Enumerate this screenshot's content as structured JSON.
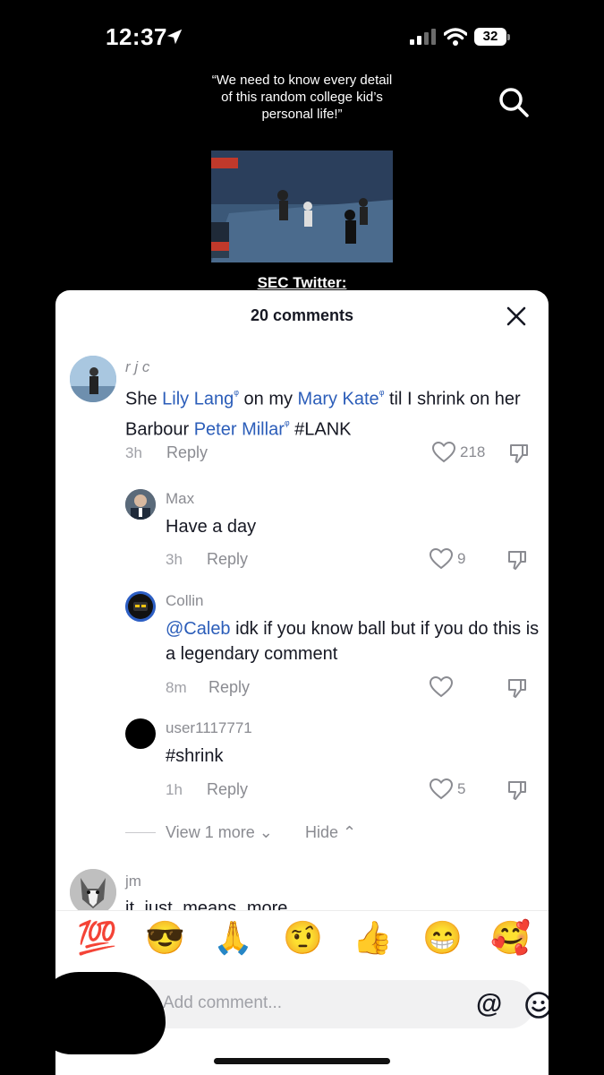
{
  "status_bar": {
    "time": "12:37",
    "battery": "32",
    "location_icon": "location-arrow-icon",
    "signal_icon": "cellular-signal-icon",
    "wifi_icon": "wifi-icon"
  },
  "video": {
    "caption_top": "“We need to know every detail of this random college kid’s personal life!”",
    "caption_bottom": "SEC Twitter:",
    "search_icon": "search-icon"
  },
  "sheet": {
    "header": "20 comments",
    "close_icon": "close-icon"
  },
  "comments": [
    {
      "user": "r j c",
      "text_parts": [
        "She ",
        "Lily Lang",
        " on my ",
        "Mary Kate",
        " til I shrink on her Barbour ",
        "Peter Millar",
        " #LANK"
      ],
      "time": "3h",
      "reply": "Reply",
      "likes": "218"
    },
    {
      "user": "Max",
      "text": "Have a day",
      "time": "3h",
      "reply": "Reply",
      "likes": "9"
    },
    {
      "user": "Collin",
      "mention": "@Caleb",
      "text": " idk if you know ball but if you do this is a legendary comment",
      "time": "8m",
      "reply": "Reply",
      "likes": ""
    },
    {
      "user": "user1117771",
      "text": "#shrink",
      "time": "1h",
      "reply": "Reply",
      "likes": "5"
    },
    {
      "user": "jm",
      "text": "it just means more"
    }
  ],
  "thread_controls": {
    "view_more": "View 1 more",
    "hide": "Hide"
  },
  "emoji_bar": [
    "💯",
    "😎",
    "🙏",
    "🤨",
    "👍",
    "😁",
    "🥰"
  ],
  "input": {
    "placeholder": "Add comment...",
    "at_label": "@"
  },
  "colors": {
    "link": "#2b5db9",
    "text": "#161823",
    "muted": "#8a8b91"
  }
}
